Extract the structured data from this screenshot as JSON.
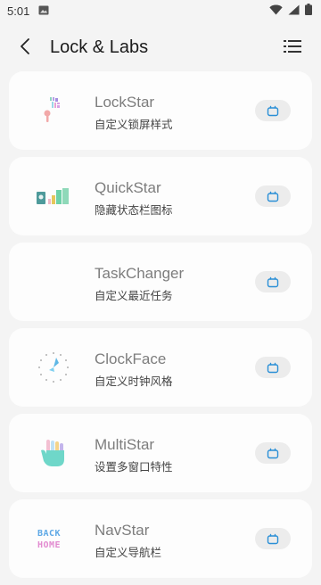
{
  "status_bar": {
    "time": "5:01"
  },
  "header": {
    "title": "Lock & Labs"
  },
  "modules": [
    {
      "title": "LockStar",
      "subtitle": "自定义锁屏样式",
      "icon": "lockstar-icon"
    },
    {
      "title": "QuickStar",
      "subtitle": "隐藏状态栏图标",
      "icon": "quickstar-icon"
    },
    {
      "title": "TaskChanger",
      "subtitle": "自定义最近任务",
      "icon": ""
    },
    {
      "title": "ClockFace",
      "subtitle": "自定义时钟风格",
      "icon": "clockface-icon"
    },
    {
      "title": "MultiStar",
      "subtitle": "设置多窗口特性",
      "icon": "multistar-icon"
    },
    {
      "title": "NavStar",
      "subtitle": "自定义导航栏",
      "icon": "navstar-icon"
    }
  ],
  "colors": {
    "accent": "#2a8fd6",
    "card": "#fdfdfd",
    "background": "#f4f4f4"
  }
}
